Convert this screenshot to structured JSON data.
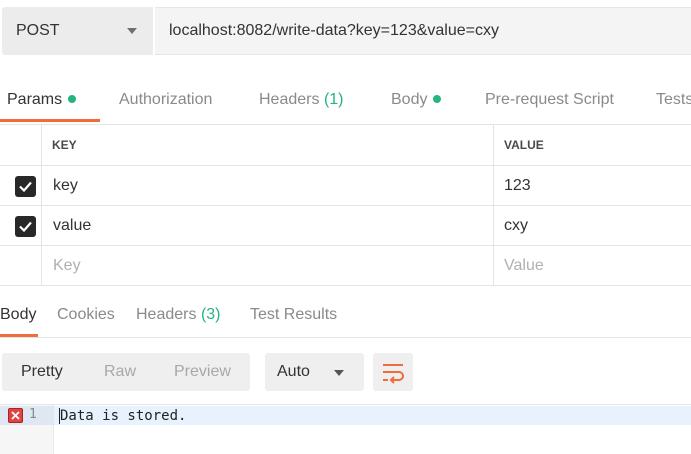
{
  "request": {
    "method": "POST",
    "url": "localhost:8082/write-data?key=123&value=cxy"
  },
  "request_tabs": [
    {
      "label": "Params",
      "has_dot": true,
      "active": true
    },
    {
      "label": "Authorization"
    },
    {
      "label": "Headers",
      "count": "(1)"
    },
    {
      "label": "Body",
      "has_dot": true
    },
    {
      "label": "Pre-request Script"
    },
    {
      "label": "Tests"
    }
  ],
  "params": {
    "headers": {
      "key": "KEY",
      "value": "VALUE"
    },
    "rows": [
      {
        "checked": true,
        "key": "key",
        "value": "123"
      },
      {
        "checked": true,
        "key": "value",
        "value": "cxy"
      }
    ],
    "placeholder": {
      "key": "Key",
      "value": "Value"
    }
  },
  "response_tabs": [
    {
      "label": "Body",
      "active": true
    },
    {
      "label": "Cookies"
    },
    {
      "label": "Headers",
      "count": "(3)"
    },
    {
      "label": "Test Results"
    }
  ],
  "response_toolbar": {
    "views": [
      "Pretty",
      "Raw",
      "Preview"
    ],
    "active_view": "Pretty",
    "format": "Auto",
    "wrap_icon": "wrap-lines-icon"
  },
  "response_body": {
    "line_number": "1",
    "text": "Data is stored."
  },
  "colors": {
    "accent": "#f26b3a",
    "status_green": "#26b47f"
  }
}
